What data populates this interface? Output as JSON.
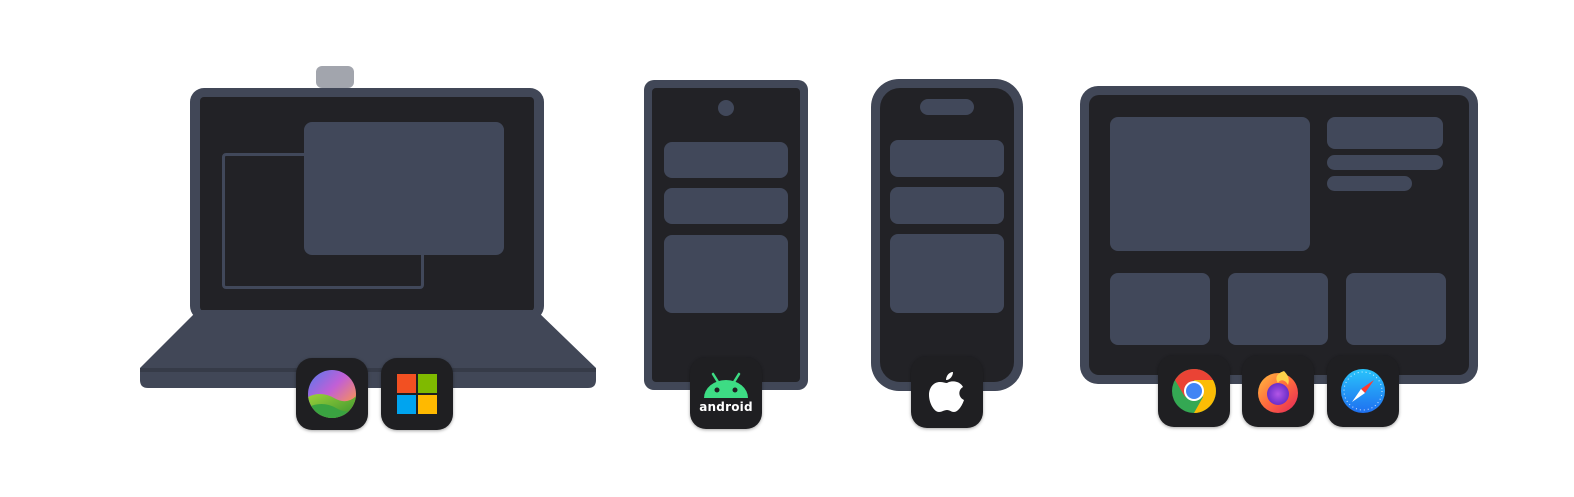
{
  "devices": {
    "laptop": {
      "os_badges": [
        "macos-icon",
        "windows-icon"
      ]
    },
    "android_phone": {
      "os_badges": [
        "android-icon"
      ],
      "badge_text": "android"
    },
    "iphone": {
      "os_badges": [
        "apple-icon"
      ]
    },
    "tablet": {
      "browser_badges": [
        "chrome-icon",
        "firefox-icon",
        "safari-icon"
      ]
    }
  }
}
